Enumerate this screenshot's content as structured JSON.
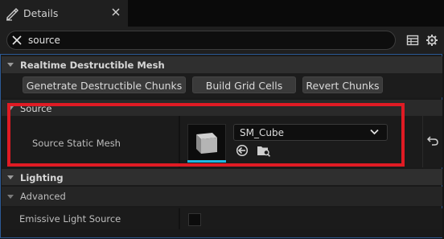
{
  "tab": {
    "title": "Details",
    "icon": "pencil-icon"
  },
  "search": {
    "value": "source",
    "placeholder": ""
  },
  "categories": {
    "realtime": {
      "title": "Realtime Destructible Mesh",
      "buttons": [
        "Genetrate Destructible Chunks",
        "Build Grid Cells",
        "Revert Chunks"
      ]
    },
    "source": {
      "title": "Source",
      "property_label": "Source Static Mesh",
      "mesh_value": "SM_Cube"
    },
    "lighting": {
      "title": "Lighting",
      "sub_title": "Advanced",
      "property_label": "Emissive Light Source"
    }
  },
  "colors": {
    "highlight": "#e01b24",
    "accent": "#1fb6e0",
    "panel_border": "#2c5a96"
  }
}
